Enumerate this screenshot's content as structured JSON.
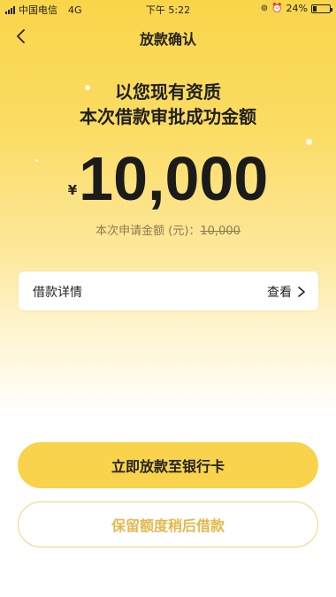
{
  "status_bar": {
    "carrier": "中国电信",
    "network": "4G",
    "time": "下午 5:22",
    "battery_percent": "24%",
    "battery_level": 0.24
  },
  "nav": {
    "back_icon": "chevron-left-icon",
    "title": "放款确认"
  },
  "approval": {
    "headline_line1": "以您现有资质",
    "headline_line2": "本次借款审批成功金额",
    "currency_symbol": "¥",
    "amount": "10,000",
    "applied_label": "本次申请金额 (元)：",
    "applied_amount": "10,000"
  },
  "detail": {
    "label": "借款详情",
    "action": "查看",
    "action_icon": "chevron-right-icon"
  },
  "actions": {
    "primary_label": "立即放款至银行卡",
    "secondary_label": "保留额度稍后借款"
  },
  "colors": {
    "accent": "#f8d34b",
    "secondary_text": "#e3b94c"
  }
}
